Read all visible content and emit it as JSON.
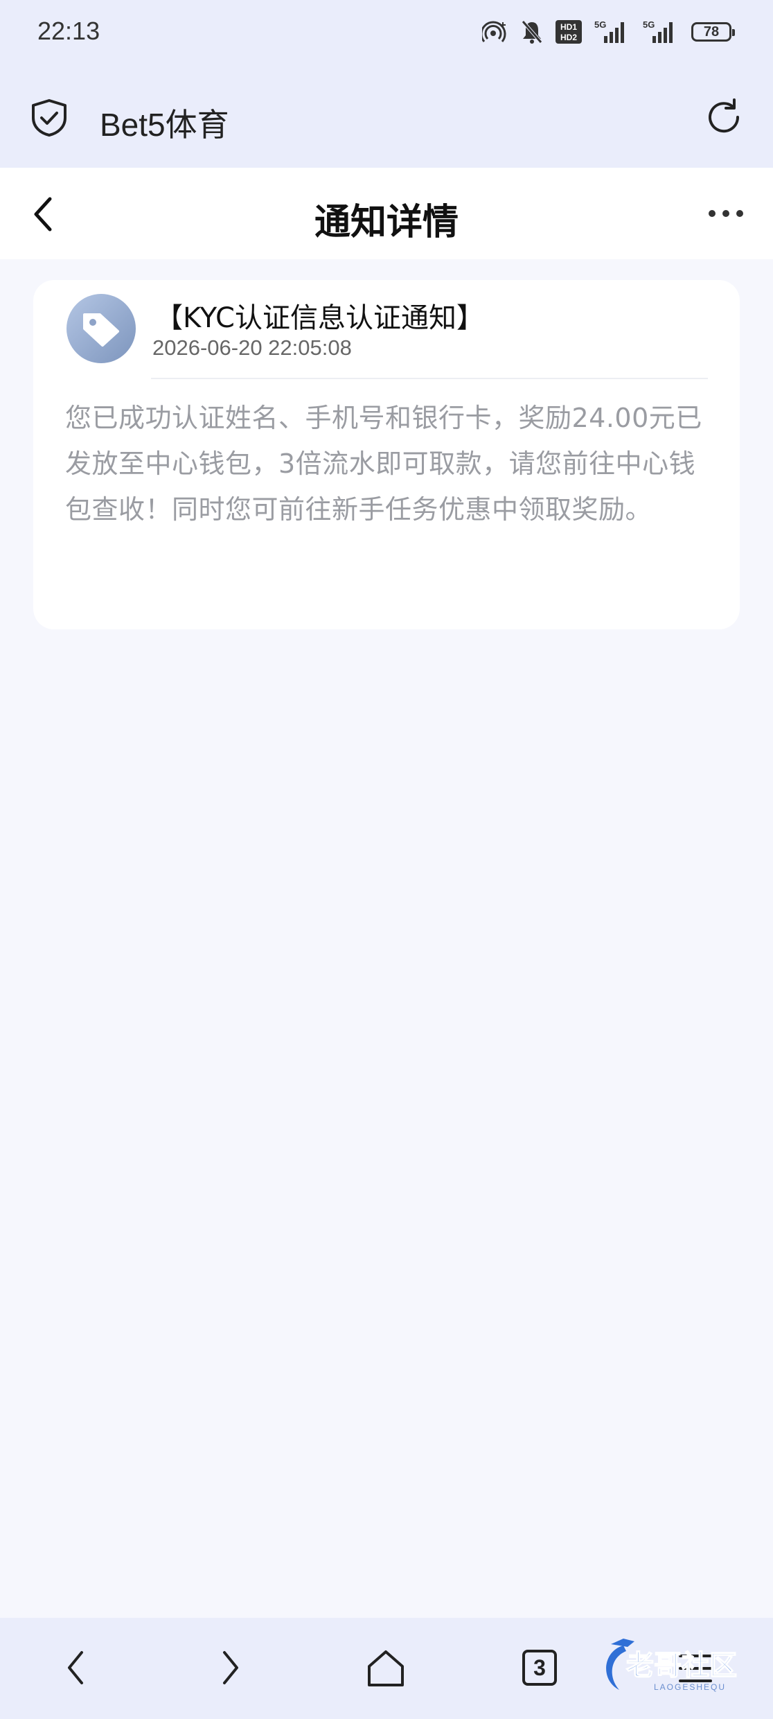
{
  "status_bar": {
    "time": "22:13",
    "hd1": "HD1",
    "hd2": "HD2",
    "network_1": "5G",
    "network_2": "5G",
    "battery": "78"
  },
  "browser": {
    "title": "Bet5体育",
    "icons": [
      "shield-check-icon",
      "refresh-icon"
    ]
  },
  "header": {
    "title": "通知详情",
    "icons": [
      "back-chevron-icon",
      "more-icon"
    ]
  },
  "notification": {
    "title": "【KYC认证信息认证通知】",
    "time": "2026-06-20 22:05:08",
    "body": "您已成功认证姓名、手机号和银行卡，奖励24.00元已发放至中心钱包，3倍流水即可取款，请您前往中心钱包查收！同时您可前往新手任务优惠中领取奖励。",
    "avatar_icon": "tag-icon"
  },
  "bottom_nav": {
    "tab_count": "3",
    "icons": [
      "nav-back-icon",
      "nav-forward-icon",
      "home-icon",
      "tabs-icon",
      "menu-icon"
    ]
  },
  "watermark": {
    "text": "老哥社区",
    "subtext": "LAOGESHEQU"
  },
  "colors": {
    "bar_background": "#eaedfb",
    "page_background": "#f6f7fd",
    "card_background": "#ffffff",
    "body_text": "#9a9ca2",
    "avatar_gradient_start": "#b4c6e4",
    "avatar_gradient_end": "#7d95bd",
    "watermark_blue": "#2f6fd6"
  }
}
